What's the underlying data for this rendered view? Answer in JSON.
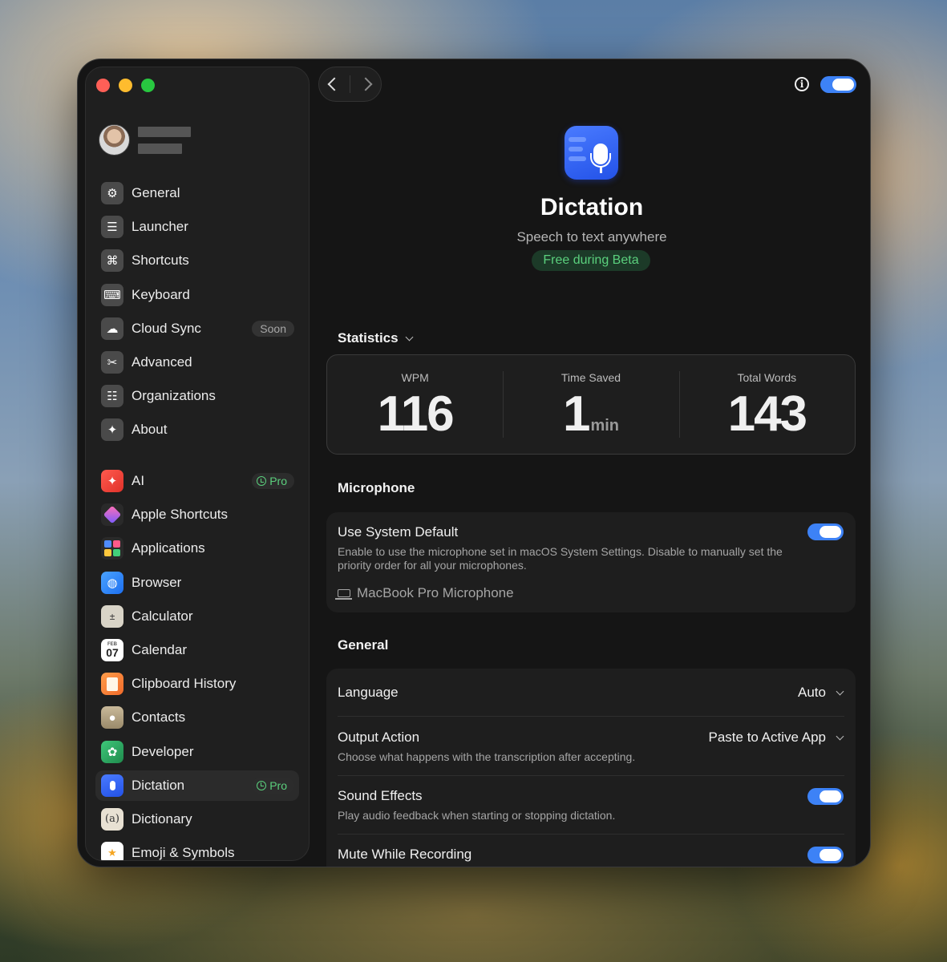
{
  "sidebar": {
    "items_top": [
      {
        "label": "General",
        "icon": "gear-icon"
      },
      {
        "label": "Launcher",
        "icon": "launcher-icon"
      },
      {
        "label": "Shortcuts",
        "icon": "command-icon"
      },
      {
        "label": "Keyboard",
        "icon": "keyboard-icon"
      },
      {
        "label": "Cloud Sync",
        "icon": "cloud-icon",
        "badge": "Soon"
      },
      {
        "label": "Advanced",
        "icon": "tools-icon"
      },
      {
        "label": "Organizations",
        "icon": "organizations-icon"
      },
      {
        "label": "About",
        "icon": "about-icon"
      }
    ],
    "items_ext": [
      {
        "label": "AI",
        "icon": "sparkle-icon",
        "badge": "Pro"
      },
      {
        "label": "Apple Shortcuts",
        "icon": "apple-shortcuts-icon"
      },
      {
        "label": "Applications",
        "icon": "applications-icon"
      },
      {
        "label": "Browser",
        "icon": "globe-icon"
      },
      {
        "label": "Calculator",
        "icon": "calculator-icon"
      },
      {
        "label": "Calendar",
        "icon": "calendar-icon",
        "icon_text_month": "FEB",
        "icon_text_day": "07"
      },
      {
        "label": "Clipboard History",
        "icon": "clipboard-icon"
      },
      {
        "label": "Contacts",
        "icon": "contacts-icon"
      },
      {
        "label": "Developer",
        "icon": "developer-icon"
      },
      {
        "label": "Dictation",
        "icon": "microphone-icon",
        "badge": "Pro",
        "active": true
      },
      {
        "label": "Dictionary",
        "icon": "dictionary-icon",
        "icon_text": "(a)"
      },
      {
        "label": "Emoji & Symbols",
        "icon": "emoji-icon"
      }
    ]
  },
  "header": {
    "title": "Dictation",
    "subtitle": "Speech to text anywhere",
    "badge": "Free during Beta"
  },
  "statistics": {
    "title": "Statistics",
    "wpm_label": "WPM",
    "wpm_value": "116",
    "time_label": "Time Saved",
    "time_value": "1",
    "time_unit": "min",
    "words_label": "Total Words",
    "words_value": "143"
  },
  "microphone": {
    "title": "Microphone",
    "system_default_title": "Use System Default",
    "system_default_desc": "Enable to use the microphone set in macOS System Settings. Disable to manually set the priority order for all your microphones.",
    "device": "MacBook Pro Microphone"
  },
  "general": {
    "title": "General",
    "language_label": "Language",
    "language_value": "Auto",
    "output_label": "Output Action",
    "output_desc": "Choose what happens with the transcription after accepting.",
    "output_value": "Paste to Active App",
    "sound_label": "Sound Effects",
    "sound_desc": "Play audio feedback when starting or stopping dictation.",
    "mute_label": "Mute While Recording"
  },
  "colors": {
    "accent": "#3d82f6",
    "pro_green": "#5bd07d"
  }
}
